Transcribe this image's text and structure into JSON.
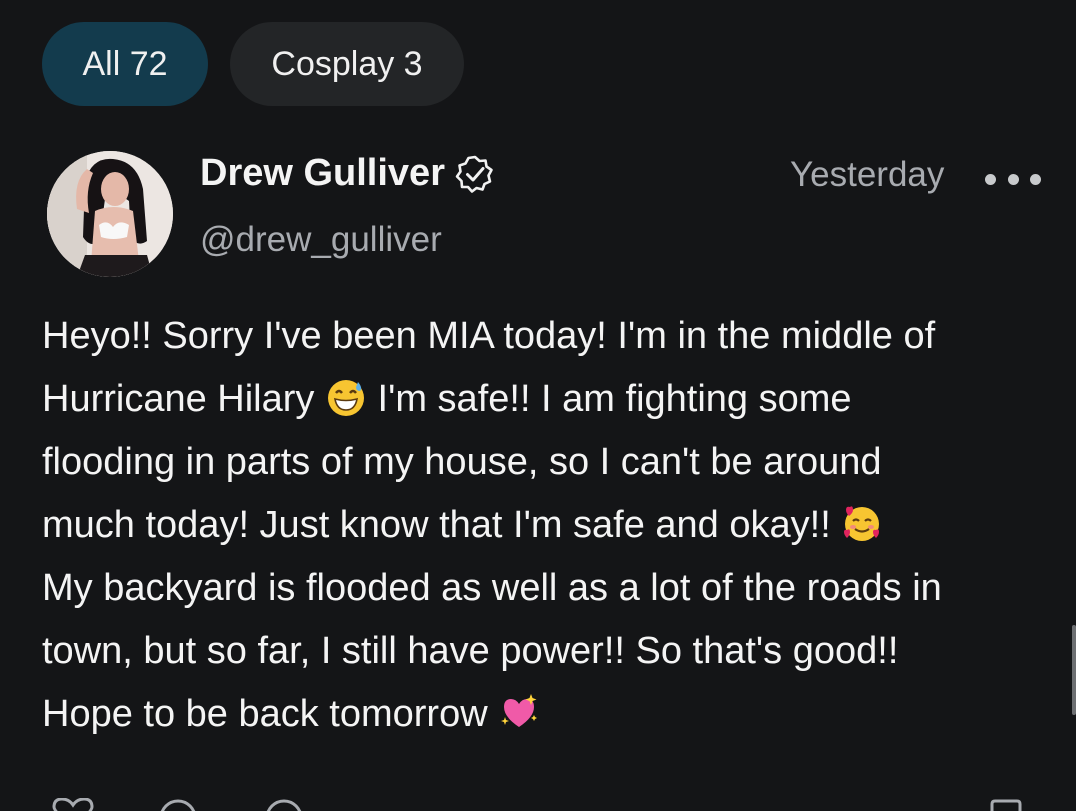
{
  "filters": {
    "all_label": "All 72",
    "cosplay_label": "Cosplay 3"
  },
  "post": {
    "author_name": "Drew Gulliver",
    "author_handle": "@drew_gulliver",
    "timestamp": "Yesterday",
    "verified_icon": "verified-badge-icon",
    "more_icon": "more-options-icon",
    "lines": [
      "Heyo!! Sorry I've been MIA today! I'm in the middle of",
      "Hurricane Hilary",
      "I'm safe!! I am fighting some",
      "flooding in parts of my house, so I can't be around",
      "much today! Just know that I'm safe and okay!!",
      "My backyard is flooded as well as a lot of the roads in",
      "town, but so far, I still have power!! So that's good!!",
      "Hope to be back tomorrow"
    ],
    "emojis": [
      "grinning-sweat-emoji",
      "smiling-face-with-hearts-emoji",
      "sparkling-heart-emoji"
    ]
  },
  "actions": [
    "like-icon",
    "comment-icon",
    "tip-icon",
    "bookmark-icon"
  ]
}
